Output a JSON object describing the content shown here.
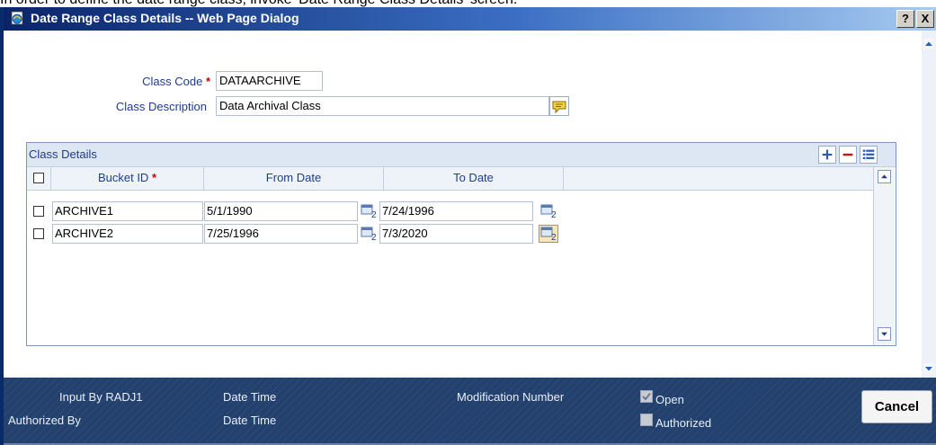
{
  "document_text": "In order to define the date range class, invoke 'Date Range Class Details' screen.",
  "window": {
    "title": "Date Range Class Details -- Web Page Dialog",
    "help_button": "?",
    "close_button": "X"
  },
  "form": {
    "class_code_label": "Class Code",
    "required_mark": "*",
    "class_code_value": "DATAARCHIVE",
    "class_description_label": "Class Description",
    "class_description_value": "Data Archival Class"
  },
  "grid": {
    "title": "Class Details",
    "buttons": [
      "add-icon",
      "remove-icon",
      "list-icon"
    ],
    "columns": [
      "Bucket ID",
      "From Date",
      "To Date"
    ],
    "rows": [
      {
        "bucket_id": "ARCHIVE1",
        "from_date": "5/1/1990",
        "to_date": "7/24/1996"
      },
      {
        "bucket_id": "ARCHIVE2",
        "from_date": "7/25/1996",
        "to_date": "7/3/2020"
      }
    ]
  },
  "footer": {
    "input_by_label": "Input By",
    "input_by_value": "RADJ1",
    "authorized_by_label": "Authorized By",
    "date_time_label_1": "Date Time",
    "date_time_label_2": "Date Time",
    "modification_number_label": "Modification Number",
    "open_label": "Open",
    "open_checked": true,
    "authorized_label": "Authorized",
    "authorized_checked": false,
    "cancel_label": "Cancel"
  },
  "colors": {
    "title_bar": "#0a246a",
    "footer_bg": "#23416e",
    "label_text": "#1f3c8c",
    "required": "#d00000"
  }
}
